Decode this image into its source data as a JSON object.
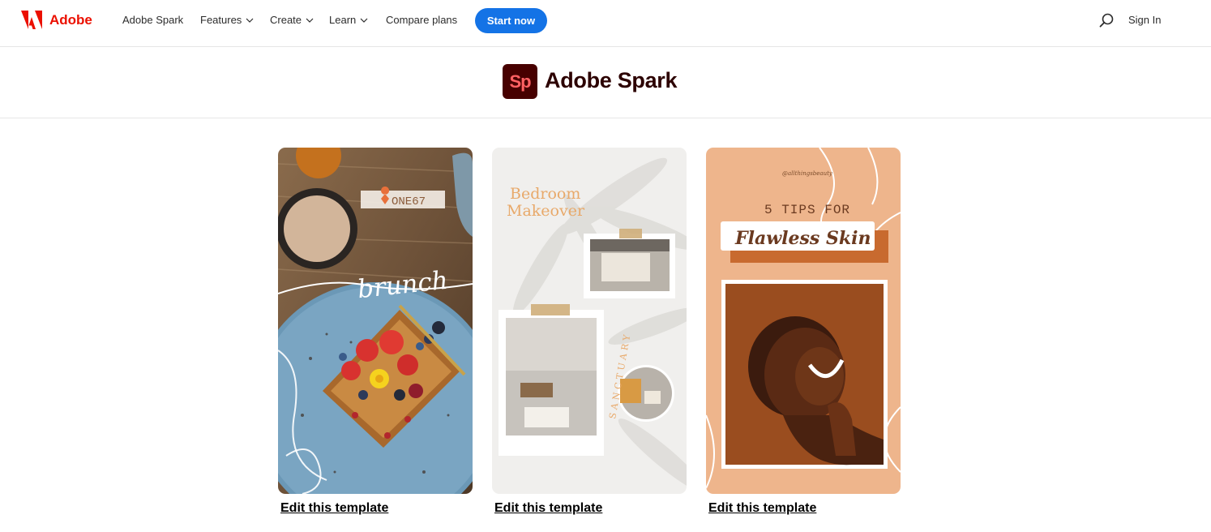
{
  "nav": {
    "brand": "Adobe",
    "items": [
      {
        "label": "Adobe Spark",
        "has_dropdown": false
      },
      {
        "label": "Features",
        "has_dropdown": true
      },
      {
        "label": "Create",
        "has_dropdown": true
      },
      {
        "label": "Learn",
        "has_dropdown": true
      },
      {
        "label": "Compare plans",
        "has_dropdown": false
      }
    ],
    "cta": "Start now",
    "search_icon": "search-icon",
    "sign_in": "Sign In"
  },
  "spark": {
    "logo_text": "Sp",
    "title": "Adobe Spark"
  },
  "colors": {
    "adobe_red": "#eb1000",
    "cta_blue": "#1473e6",
    "spark_logo_bg": "#470000",
    "spark_logo_fg": "#ff6163"
  },
  "templates": [
    {
      "location_tag": "ONE67",
      "script_text": "brunch",
      "link": "Edit this template"
    },
    {
      "title_line1": "Bedroom",
      "title_line2": "Makeover",
      "circle_text": "SANCTUARY",
      "link": "Edit this template"
    },
    {
      "handle": "@allthingsbeauty",
      "heading": "5 TIPS FOR",
      "banner": "Flawless Skin",
      "link": "Edit this template"
    }
  ]
}
